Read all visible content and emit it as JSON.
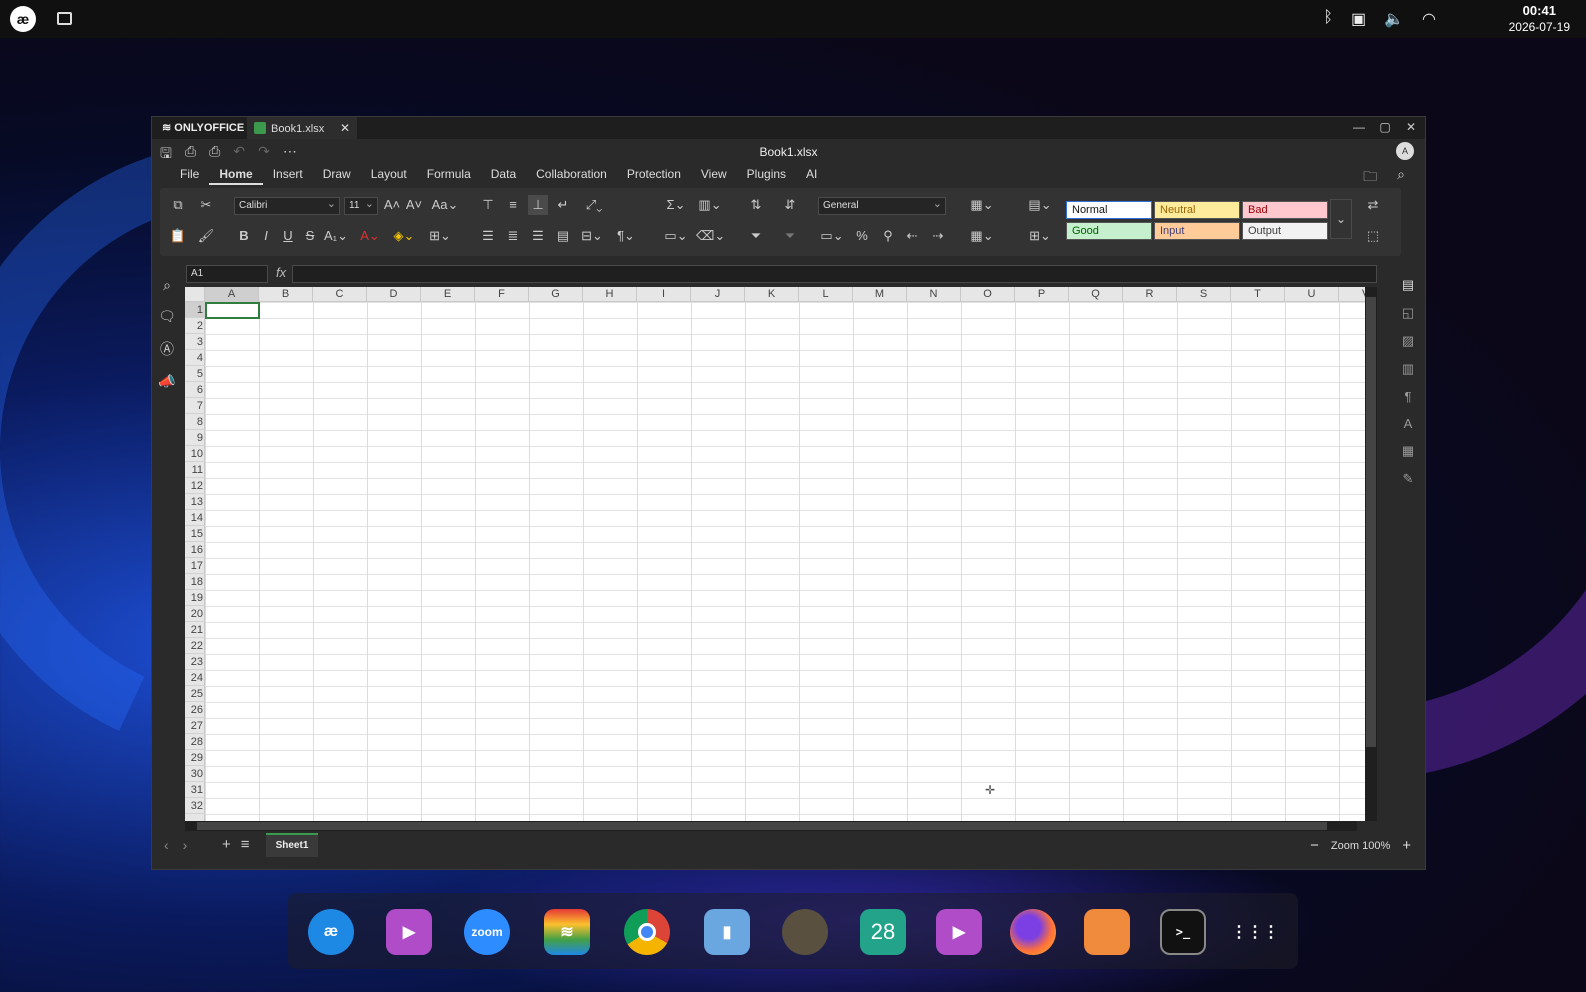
{
  "topbar": {
    "logo": "æ",
    "clock_time": "00:41",
    "clock_date": "2026-07-19",
    "tray_icons": [
      "bluetooth-icon",
      "clipboard-icon",
      "volume-icon",
      "wifi-icon"
    ]
  },
  "window": {
    "brand": "ONLYOFFICE",
    "tab_label": "Book1.xlsx",
    "doc_title": "Book1.xlsx",
    "avatar": "A"
  },
  "menu": {
    "items": [
      "File",
      "Home",
      "Insert",
      "Draw",
      "Layout",
      "Formula",
      "Data",
      "Collaboration",
      "Protection",
      "View",
      "Plugins",
      "AI"
    ],
    "active": "Home"
  },
  "ribbon": {
    "font_name": "Calibri",
    "font_size": "11",
    "number_format": "General",
    "styles": [
      "Normal",
      "Neutral",
      "Bad",
      "Good",
      "Input",
      "Output"
    ]
  },
  "formula_bar": {
    "name_box": "A1",
    "fx": "fx",
    "value": ""
  },
  "grid": {
    "columns": [
      "A",
      "B",
      "C",
      "D",
      "E",
      "F",
      "G",
      "H",
      "I",
      "J",
      "K",
      "L",
      "M",
      "N",
      "O",
      "P",
      "Q",
      "R",
      "S",
      "T",
      "U",
      "V"
    ],
    "rows": [
      "1",
      "2",
      "3",
      "4",
      "5",
      "6",
      "7",
      "8",
      "9",
      "10",
      "11",
      "12",
      "13",
      "14",
      "15",
      "16",
      "17",
      "18",
      "19",
      "20",
      "21",
      "22",
      "23",
      "24",
      "25",
      "26",
      "27",
      "28",
      "29",
      "30",
      "31",
      "32"
    ]
  },
  "sheetbar": {
    "sheet_name": "Sheet1",
    "zoom_label": "Zoom 100%"
  },
  "dock": {
    "apps": [
      "æ",
      "▶",
      "zoom",
      "≋",
      "",
      "▮",
      "",
      "28",
      "▶",
      "",
      "",
      ">_",
      "⋮⋮⋮"
    ]
  }
}
